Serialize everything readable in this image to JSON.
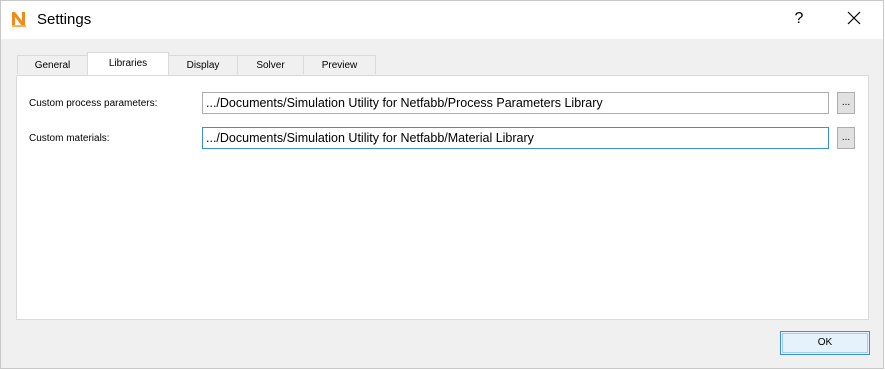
{
  "window": {
    "title": "Settings",
    "help_label": "?",
    "app_icon": "netfabb-n-icon",
    "accent_color": "#f08a1c"
  },
  "tabs": [
    {
      "label": "General",
      "active": false
    },
    {
      "label": "Libraries",
      "active": true
    },
    {
      "label": "Display",
      "active": false
    },
    {
      "label": "Solver",
      "active": false
    },
    {
      "label": "Preview",
      "active": false
    }
  ],
  "libraries": {
    "process_params": {
      "label": "Custom process parameters:",
      "value": ".../Documents/Simulation Utility for Netfabb/Process Parameters Library",
      "browse_label": "..."
    },
    "materials": {
      "label": "Custom materials:",
      "value": ".../Documents/Simulation Utility for Netfabb/Material Library",
      "browse_label": "..."
    }
  },
  "footer": {
    "ok_label": "OK"
  }
}
